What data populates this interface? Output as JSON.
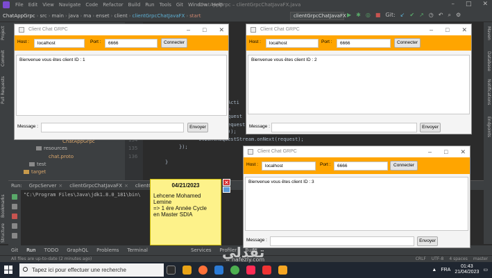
{
  "ide": {
    "window_title": "ChatAppGrpc – clientGrpcChatJavaFX.java",
    "menu": [
      "File",
      "Edit",
      "View",
      "Navigate",
      "Code",
      "Refactor",
      "Build",
      "Run",
      "Tools",
      "Git",
      "Window",
      "Help"
    ],
    "breadcrumb": [
      "ChatAppGrpc",
      "src",
      "main",
      "java",
      "ma",
      "enset",
      "client",
      "clientGrpcChatJavaFX",
      "start"
    ],
    "run_config": "clientGrpcChatJavaFX",
    "git_label": "Git:",
    "left_tools": [
      "Project",
      "Commit",
      "Pull Requests"
    ],
    "right_tools": [
      "Maven",
      "Database",
      "Notifications",
      "Endpoints"
    ],
    "left_tools_lower": [
      "Bookmarks",
      "Structure"
    ],
    "project_tree": [
      {
        "label": "ChatAppGrpc",
        "type": "file"
      },
      {
        "label": "resources",
        "type": "folder"
      },
      {
        "label": "chat.proto",
        "type": "file"
      },
      {
        "label": "test",
        "type": "folder"
      },
      {
        "label": "target",
        "type": "folder"
      }
    ],
    "gutter_lines": [
      "134",
      "135",
      "136"
    ],
    "code_lines": [
      "Acti",
      "= ",
      "quest",
      "equest",
      "));",
      "clientRequestStream.onNext(request);",
      "});",
      "}"
    ],
    "run_label": "Run:",
    "run_tabs": [
      "GrpcServer",
      "clientGrpcChatJavaFX",
      "clientGrpcChatJavaFX"
    ],
    "console_line": "\"C:\\Program Files\\Java\\jdk1.8.0_181\\bin\\",
    "bottom_tools": [
      "Git",
      "Run",
      "TODO",
      "GraphQL",
      "Problems",
      "Terminal",
      "Services",
      "Profiler",
      "Build"
    ],
    "status_left": "All files are up-to-date (2 minutes ago)",
    "status_right": [
      "CRLF",
      "UTF-8",
      "4 spaces",
      "master"
    ]
  },
  "taskbar": {
    "search_placeholder": "Tapez ici pour effectuer une recherche",
    "lang": "FRA",
    "time": "01:43",
    "date": "21/04/2023"
  },
  "windows": [
    {
      "title": "Client Chat GRPC",
      "host_label": "Host :",
      "host": "localhost",
      "port_label": "Port :",
      "port": "6666",
      "connect": "Connecter",
      "welcome": "Bienvenue vous êtes client ID : 1",
      "message_label": "Message :",
      "send": "Envoyer"
    },
    {
      "title": "Client Chat GRPC",
      "host_label": "Host :",
      "host": "localhost",
      "port_label": "Port :",
      "port": "6666",
      "connect": "Connecter",
      "welcome": "Bienvenue vous êtes client ID : 2",
      "message_label": "Message :",
      "send": "Envoyer"
    },
    {
      "title": "Client Chat GRPC",
      "host_label": "Host :",
      "host": "localhost",
      "port_label": "Port :",
      "port": "6666",
      "connect": "Connecter",
      "welcome": "Bienvenue vous êtes client ID : 3",
      "message_label": "Message :",
      "send": "Envoyer"
    }
  ],
  "note": {
    "date": "04/21/2023",
    "lines": [
      "Lehcene Mohamed",
      "Lemine",
      "=> 1 ére Année Cycle",
      "en Master SDIA"
    ]
  },
  "watermark": {
    "text": "تقدلي",
    "sub": "nafezly.com"
  },
  "colors": {
    "orange_header": "#ffa500",
    "ide_bg": "#2b2b2b",
    "note_yellow": "#fdf28a"
  }
}
